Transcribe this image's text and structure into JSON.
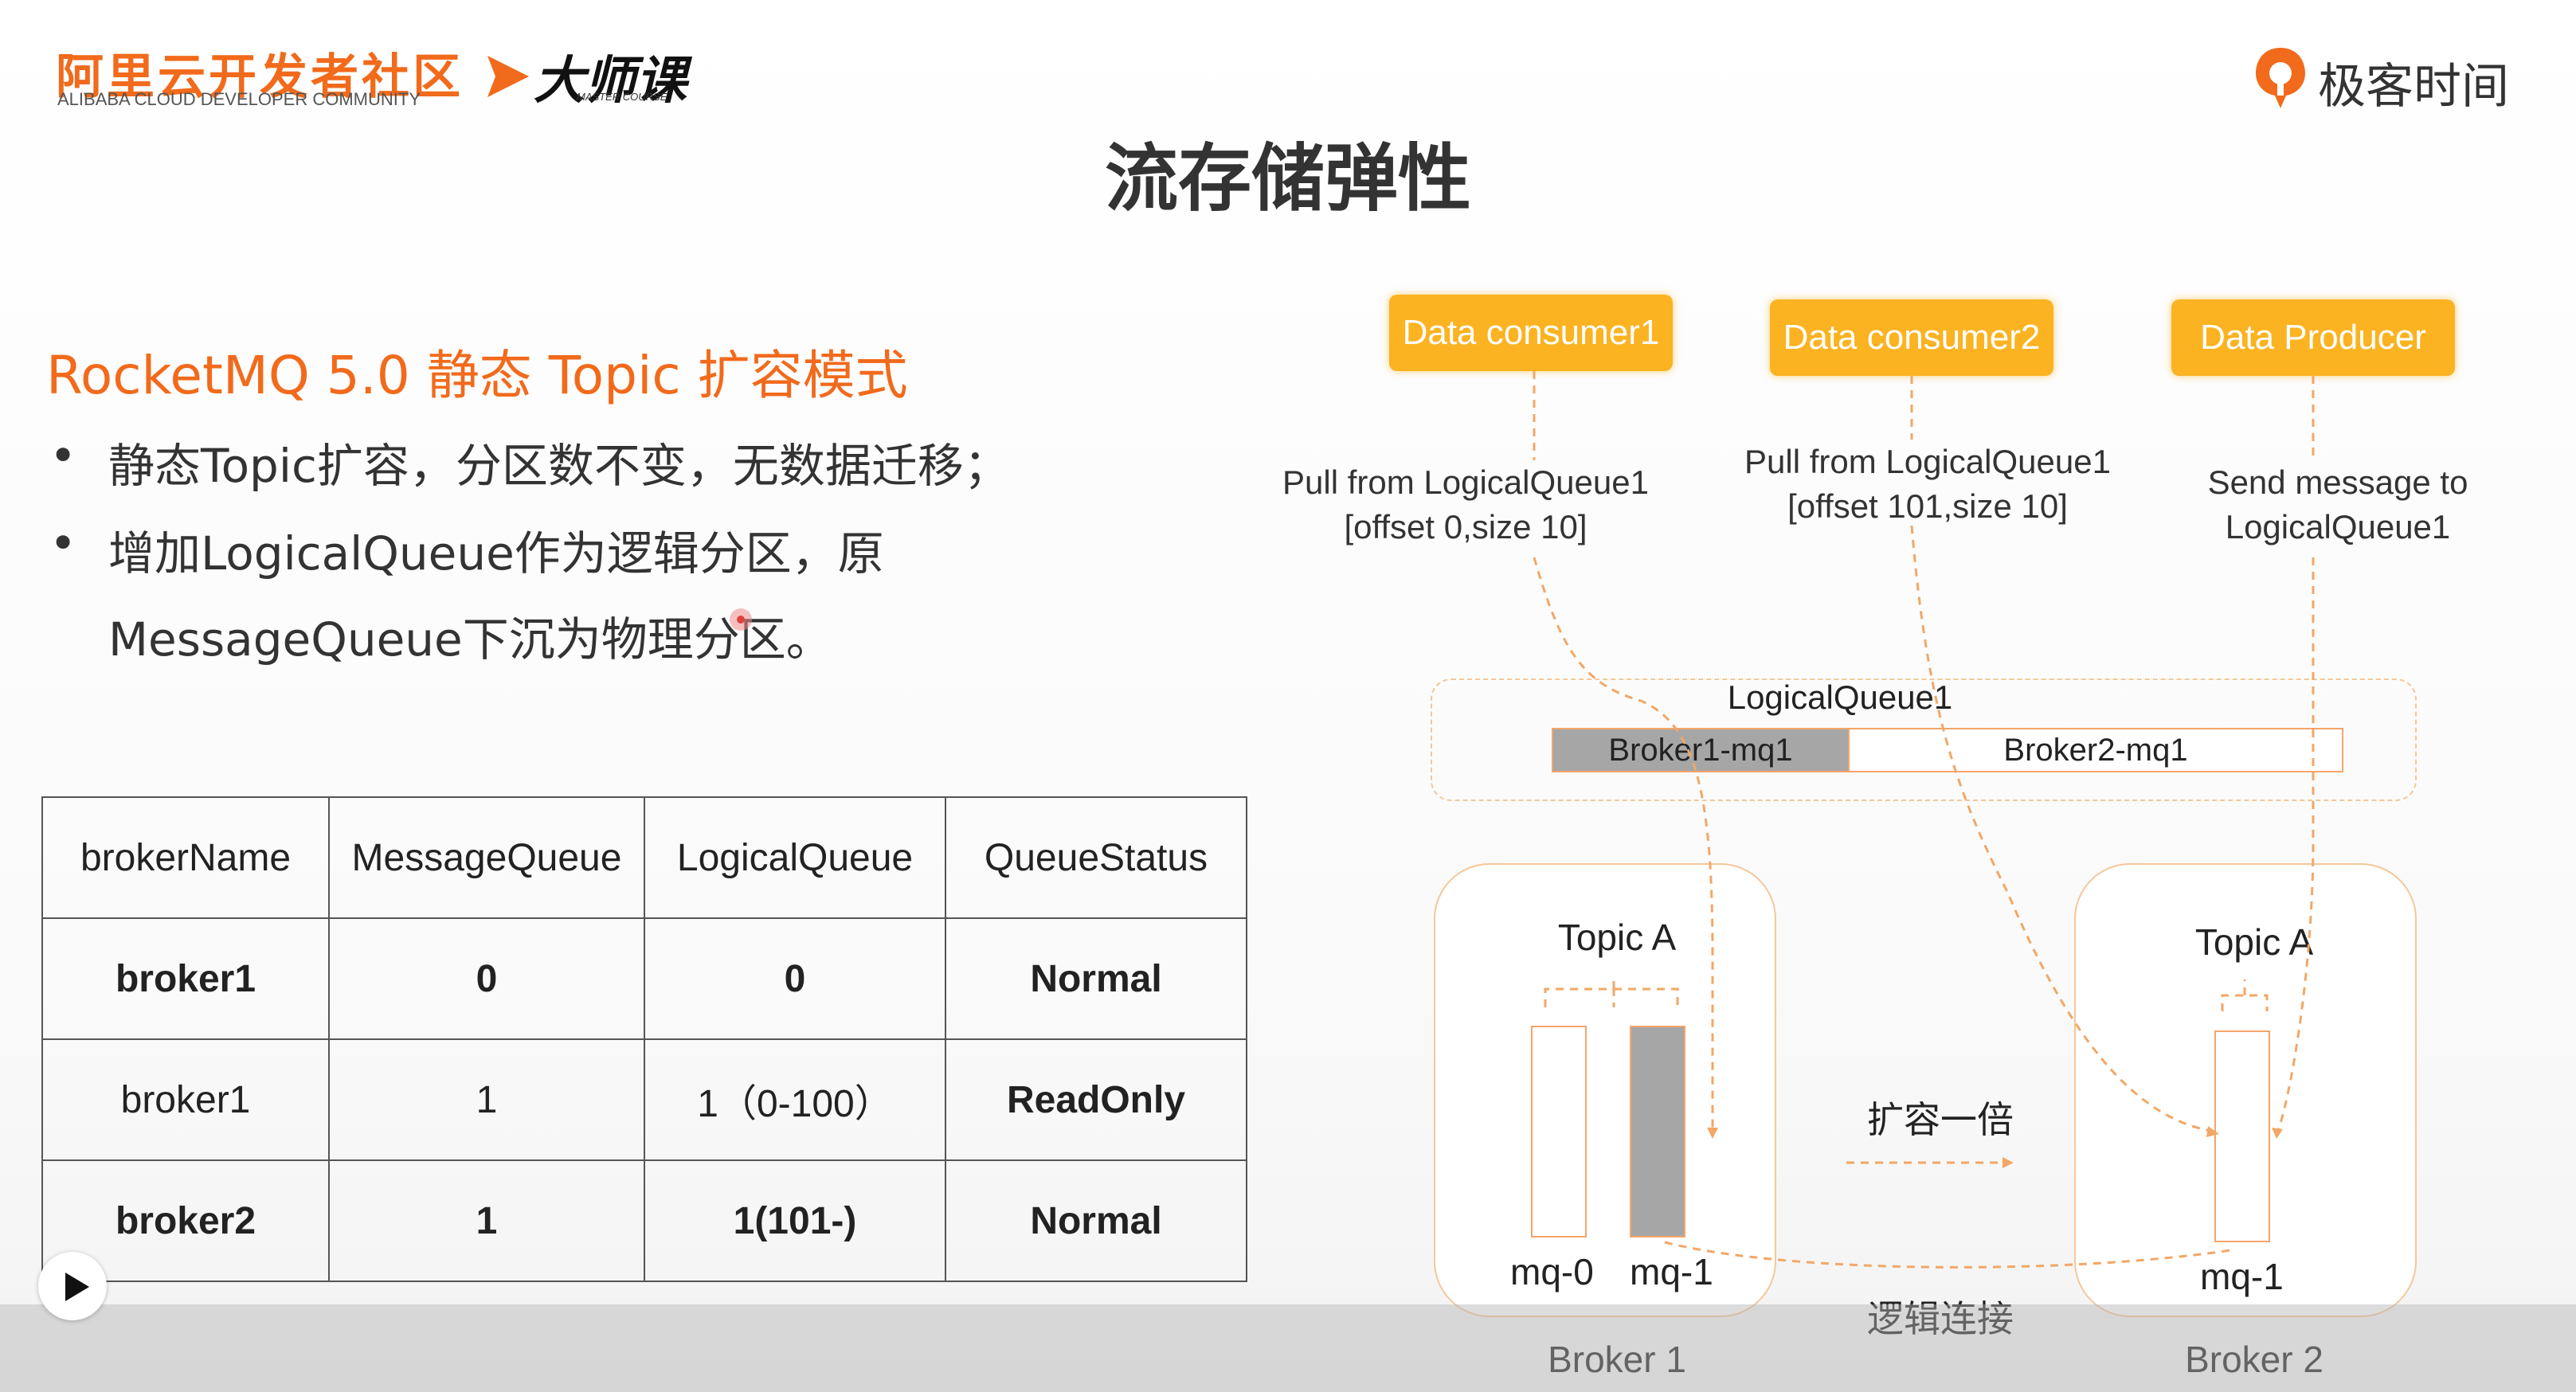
{
  "header": {
    "aliyun_name": "阿里云开发者社区",
    "aliyun_en": "ALIBABA CLOUD DEVELOPER COMMUNITY",
    "master_name": "大师课",
    "master_en": "MASTER COURSE",
    "geek_name": "极客时间"
  },
  "slide": {
    "title": "流存储弹性",
    "subtitle": "RocketMQ 5.0 静态 Topic 扩容模式",
    "bullets": [
      "静态Topic扩容，分区数不变，无数据迁移；",
      "增加LogicalQueue作为逻辑分区，原",
      "MessageQueue下沉为物理分区。"
    ],
    "bullet_symbol": "•"
  },
  "table": {
    "headers": [
      "brokerName",
      "MessageQueue",
      "LogicalQueue",
      "QueueStatus"
    ],
    "rows": [
      [
        "broker1",
        "0",
        "0",
        "Normal"
      ],
      [
        "broker1",
        "1",
        "1（0-100）",
        "ReadOnly"
      ],
      [
        "broker2",
        "1",
        "1(101-)",
        "Normal"
      ]
    ]
  },
  "diagram": {
    "consumer1": "Data consumer1",
    "consumer2": "Data consumer2",
    "producer": "Data Producer",
    "consumer1_note": [
      "Pull  from LogicalQueue1",
      "[offset 0,size 10]"
    ],
    "consumer2_note": [
      "Pull  from LogicalQueue1",
      "[offset 101,size 10]"
    ],
    "producer_note": [
      "Send message to",
      "LogicalQueue1"
    ],
    "logical_queue": "LogicalQueue1",
    "lq_part1": "Broker1-mq1",
    "lq_part2": "Broker2-mq1",
    "broker1_topic": "Topic A",
    "broker2_topic": "Topic A",
    "broker1_mq0": "mq-0",
    "broker1_mq1": "mq-1",
    "broker2_mq1": "mq-1",
    "expand_label": "扩容一倍",
    "link_label": "逻辑连接",
    "broker1_name": "Broker 1",
    "broker2_name": "Broker 2"
  },
  "colors": {
    "accent_orange": "#f26a1b",
    "button_yellow": "#fbb321",
    "table_green": "#2e7d1a",
    "table_red": "#c00000"
  }
}
